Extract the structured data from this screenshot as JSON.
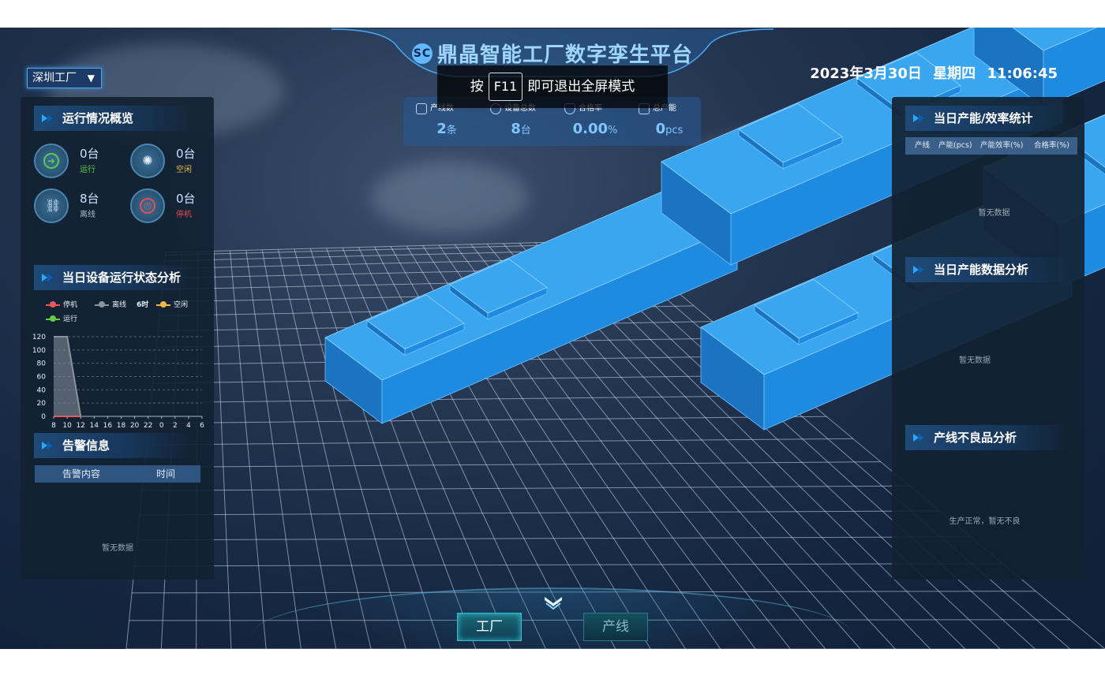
{
  "header": {
    "logo_text": "SC",
    "title": "鼎晶智能工厂数字孪生平台",
    "factory_select": "深圳工厂",
    "date": "2023年3月30日",
    "weekday": "星期四",
    "time": "11:06:45"
  },
  "fullscreen_hint": {
    "prefix": "按",
    "key": "F11",
    "suffix": "即可退出全屏模式"
  },
  "stats": [
    {
      "label": "产线数",
      "value": "2",
      "unit": "条",
      "icon": "flow-icon"
    },
    {
      "label": "设备总数",
      "value": "8",
      "unit": "台",
      "icon": "signal-icon"
    },
    {
      "label": "合格率",
      "value": "0.00",
      "unit": "%",
      "icon": "shield-icon"
    },
    {
      "label": "总产能",
      "value": "0",
      "unit": "pcs",
      "icon": "clipboard-icon"
    }
  ],
  "left": {
    "overview_title": "运行情况概览",
    "status": [
      {
        "count": "0台",
        "label": "运行",
        "color": "#5ec94b",
        "icon": "arrow-right-icon"
      },
      {
        "count": "0台",
        "label": "空闲",
        "color": "#f0b848",
        "icon": "loading-icon"
      },
      {
        "count": "8台",
        "label": "离线",
        "color": "#a9bccd",
        "icon": "link-icon"
      },
      {
        "count": "0台",
        "label": "停机",
        "color": "#e84c4c",
        "icon": "power-icon"
      }
    ],
    "analysis_title": "当日设备运行状态分析",
    "legend": [
      {
        "name": "停机",
        "color": "#e85a5a"
      },
      {
        "name": "离线",
        "color": "#8a949e"
      },
      {
        "name": "空闲",
        "color": "#f0b848"
      },
      {
        "name": "运行",
        "color": "#66cc44"
      }
    ],
    "legend_page": "6时",
    "alarm_title": "告警信息",
    "alarm_columns": [
      "告警内容",
      "时间"
    ],
    "alarm_empty": "暂无数据"
  },
  "chart_data": {
    "type": "area",
    "x": [
      "8",
      "10",
      "12",
      "14",
      "16",
      "18",
      "20",
      "22",
      "0",
      "2",
      "4",
      "6"
    ],
    "yticks": [
      0,
      20,
      40,
      60,
      80,
      100,
      120
    ],
    "ylim": [
      0,
      120
    ],
    "series": [
      {
        "name": "离线",
        "color": "#8a949e",
        "values": [
          120,
          120,
          0,
          0,
          0,
          0,
          0,
          0,
          0,
          0,
          0,
          0
        ]
      },
      {
        "name": "运行",
        "color": "#66cc44",
        "values": [
          0,
          0,
          0,
          0,
          0,
          0,
          0,
          0,
          0,
          0,
          0,
          0
        ]
      },
      {
        "name": "停机",
        "color": "#e85a5a",
        "values": [
          0,
          0,
          0,
          0,
          0,
          0,
          0,
          0,
          0,
          0,
          0,
          0
        ]
      }
    ]
  },
  "right": {
    "efficiency_title": "当日产能/效率统计",
    "efficiency_columns": [
      "产线",
      "产能(pcs)",
      "产能效率(%)",
      "合格率(%)"
    ],
    "efficiency_empty": "暂无数据",
    "capacity_title": "当日产能数据分析",
    "capacity_empty": "暂无数据",
    "defect_title": "产线不良品分析",
    "defect_empty": "生产正常，暂无不良"
  },
  "bottom_nav": {
    "factory": "工厂",
    "line": "产线"
  }
}
